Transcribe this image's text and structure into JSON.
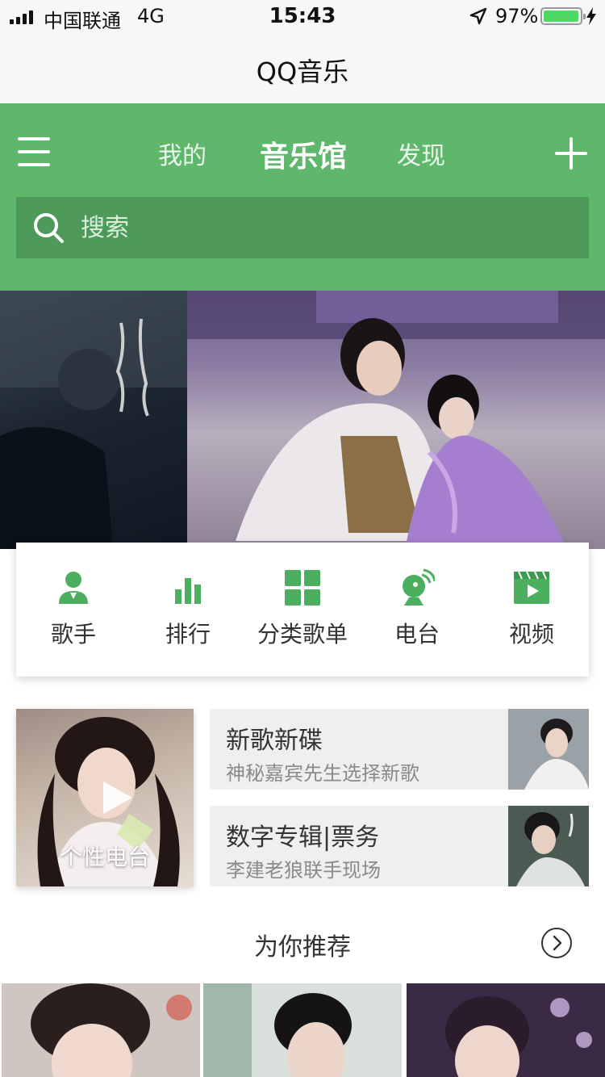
{
  "status_bar": {
    "carrier": "中国联通",
    "network": "4G",
    "time": "15:43",
    "battery_percent": "97%",
    "battery_level": 0.97
  },
  "title_bar": {
    "title": "QQ音乐"
  },
  "header": {
    "tabs": [
      {
        "label": "我的",
        "active": false
      },
      {
        "label": "音乐馆",
        "active": true
      },
      {
        "label": "发现",
        "active": false
      }
    ],
    "search_placeholder": "搜索",
    "accent_color": "#5fb76c"
  },
  "banner": {
    "poster_alt": "香蜜沉沉烬如霜 poster",
    "still_alt": "drama still"
  },
  "shortcuts": [
    {
      "label": "歌手",
      "icon": "singer-icon"
    },
    {
      "label": "排行",
      "icon": "chart-icon"
    },
    {
      "label": "分类歌单",
      "icon": "grid-icon"
    },
    {
      "label": "电台",
      "icon": "radio-icon"
    },
    {
      "label": "视频",
      "icon": "video-icon"
    }
  ],
  "features": {
    "radio_label": "个性电台",
    "promos": [
      {
        "title": "新歌新碟",
        "subtitle": "神秘嘉宾先生选择新歌"
      },
      {
        "title": "数字专辑|票务",
        "subtitle": "李建老狼联手现场"
      }
    ]
  },
  "recommend": {
    "title": "为你推荐"
  }
}
